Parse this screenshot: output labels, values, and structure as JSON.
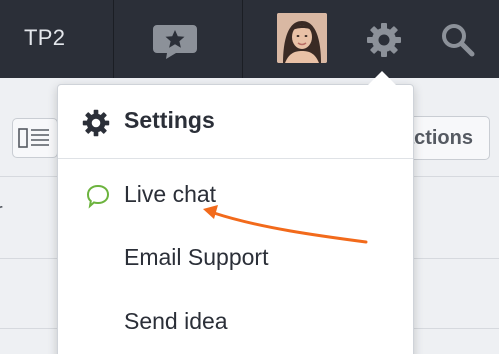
{
  "topbar": {
    "title": "TP2",
    "icons": [
      "chat-star-icon",
      "avatar",
      "gear-icon",
      "search-icon"
    ]
  },
  "background": {
    "actions_button_label": "actions",
    "left_fragment": "r"
  },
  "dropdown": {
    "title": "Settings",
    "title_icon": "gear-icon",
    "items": [
      {
        "label": "Live chat",
        "icon": "chat-bubble-icon"
      },
      {
        "label": "Email Support"
      },
      {
        "label": "Send idea"
      }
    ]
  },
  "colors": {
    "topbar_bg": "#2b2f38",
    "live_chat_icon": "#6cb33e",
    "annotation_arrow": "#f26a1b"
  }
}
